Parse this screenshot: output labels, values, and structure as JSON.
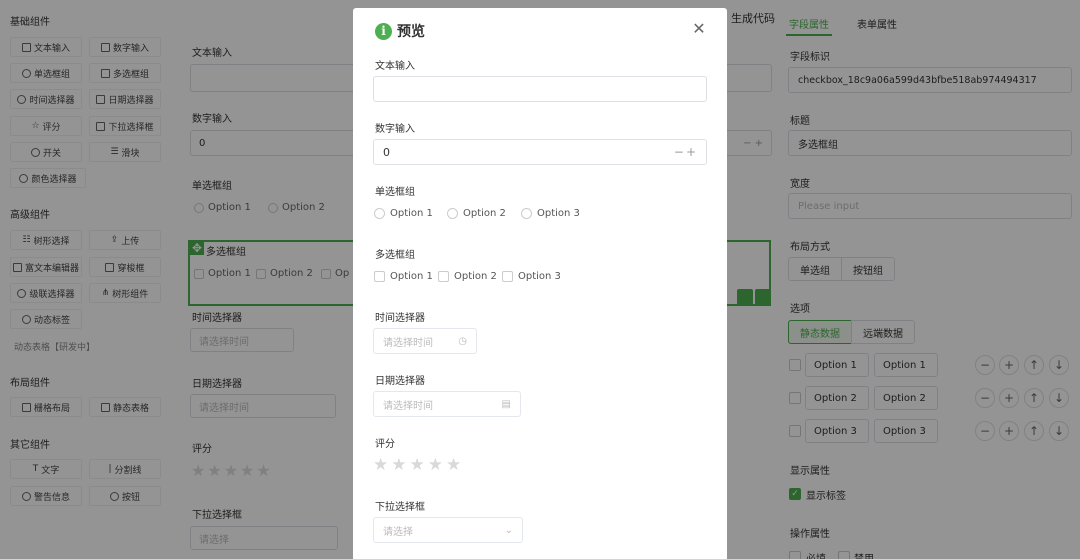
{
  "left": {
    "basic_title": "基础组件",
    "basic": [
      {
        "label": "文本输入",
        "icon": "text-input-icon"
      },
      {
        "label": "数字输入",
        "icon": "number-input-icon"
      },
      {
        "label": "单选框组",
        "icon": "radio-icon"
      },
      {
        "label": "多选框组",
        "icon": "checkbox-icon"
      },
      {
        "label": "时间选择器",
        "icon": "clock-icon"
      },
      {
        "label": "日期选择器",
        "icon": "calendar-icon"
      },
      {
        "label": "评分",
        "icon": "star-icon"
      },
      {
        "label": "下拉选择框",
        "icon": "dropdown-icon"
      },
      {
        "label": "开关",
        "icon": "switch-icon"
      },
      {
        "label": "滑块",
        "icon": "slider-icon"
      },
      {
        "label": "颜色选择器",
        "icon": "palette-icon"
      }
    ],
    "advanced_title": "高级组件",
    "advanced": [
      {
        "label": "树形选择",
        "icon": "tree-select-icon"
      },
      {
        "label": "上传",
        "icon": "upload-icon"
      },
      {
        "label": "富文本编辑器",
        "icon": "rich-text-icon"
      },
      {
        "label": "穿梭框",
        "icon": "transfer-icon"
      },
      {
        "label": "级联选择器",
        "icon": "cascader-icon"
      },
      {
        "label": "树形组件",
        "icon": "tree-icon"
      },
      {
        "label": "动态标签",
        "icon": "tag-icon"
      }
    ],
    "dynamic_table": "动态表格【研发中】",
    "layout_title": "布局组件",
    "layout": [
      {
        "label": "栅格布局",
        "icon": "grid-icon"
      },
      {
        "label": "静态表格",
        "icon": "table-icon"
      }
    ],
    "other_title": "其它组件",
    "other": [
      {
        "label": "文字",
        "icon": "text-icon"
      },
      {
        "label": "分割线",
        "icon": "divider-icon"
      },
      {
        "label": "警告信息",
        "icon": "alert-icon"
      },
      {
        "label": "按钮",
        "icon": "button-icon"
      }
    ]
  },
  "canvas": {
    "gen_code": "生成代码",
    "text_label": "文本输入",
    "number_label": "数字输入",
    "number_value": "0",
    "radio_label": "单选框组",
    "radio_opts": [
      "Option 1",
      "Option 2"
    ],
    "checkbox_label": "多选框组",
    "checkbox_opts": [
      "Option 1",
      "Option 2",
      "Op"
    ],
    "time_label": "时间选择器",
    "time_placeholder": "请选择时间",
    "date_label": "日期选择器",
    "date_placeholder": "请选择时间",
    "rate_label": "评分",
    "select_label": "下拉选择框",
    "select_placeholder": "请选择"
  },
  "right": {
    "tab_field": "字段属性",
    "tab_form": "表单属性",
    "field_id_label": "字段标识",
    "field_id_value": "checkbox_18c9a06a599d43bfbe518ab974494317",
    "title_label": "标题",
    "title_value": "多选框组",
    "width_label": "宽度",
    "width_placeholder": "Please input",
    "layout_label": "布局方式",
    "layout_opts": [
      "单选组",
      "按钮组"
    ],
    "options_label": "选项",
    "data_opts": [
      "静态数据",
      "远端数据"
    ],
    "option_rows": [
      {
        "label": "Option 1",
        "value": "Option 1"
      },
      {
        "label": "Option 2",
        "value": "Option 2"
      },
      {
        "label": "Option 3",
        "value": "Option 3"
      }
    ],
    "display_label": "显示属性",
    "show_label": "显示标签",
    "op_label": "操作属性",
    "required": "必填",
    "disabled": "禁用"
  },
  "dialog": {
    "title": "预览",
    "text_label": "文本输入",
    "text_value": "",
    "number_label": "数字输入",
    "number_value": "0",
    "radio_label": "单选框组",
    "radio_options": [
      "Option 1",
      "Option 2",
      "Option 3"
    ],
    "checkbox_label": "多选框组",
    "checkbox_options": [
      "Option 1",
      "Option 2",
      "Option 3"
    ],
    "time_label": "时间选择器",
    "time_placeholder": "请选择时间",
    "date_label": "日期选择器",
    "date_placeholder": "请选择时间",
    "rate_label": "评分",
    "rate_value": 0,
    "rate_max": 5,
    "select_label": "下拉选择框",
    "select_placeholder": "请选择"
  },
  "colors": {
    "accent": "#4caf50",
    "overlay": "rgba(0,0,0,0.42)"
  }
}
